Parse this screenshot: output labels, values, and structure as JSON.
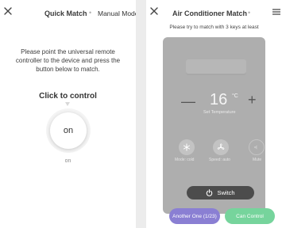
{
  "quick_match": {
    "close_icon": "close-icon",
    "tabs": {
      "quick": "Quick Match",
      "manual": "Manual Mode"
    },
    "instruction": "Please point the universal remote controller to the device and press the button below to match.",
    "click_to_control": "Click to control",
    "on_button": "on",
    "on_caption": "on"
  },
  "ac_match": {
    "close_icon": "close-icon",
    "title": "Air Conditioner Match",
    "subtitle": "Please try to match with 3 keys at least",
    "menu_icon": "menu-icon",
    "temperature": {
      "minus": "—",
      "value": "16",
      "unit": "°C",
      "plus": "+",
      "label": "Set Temperature"
    },
    "controls": [
      {
        "label": "Mode: cold",
        "icon": "snowflake-icon"
      },
      {
        "label": "Speed: auto",
        "icon": "fan-icon"
      },
      {
        "label": "Mute",
        "icon": "mute-icon"
      }
    ],
    "switch_label": "Switch",
    "another_label": "Another One (1/23)",
    "can_control_label": "Can Control"
  },
  "colors": {
    "panel": "#aeaeae",
    "another_button": "#8a7fd3",
    "can_control_button": "#76d49c",
    "switch_button": "#4c4c4c"
  }
}
